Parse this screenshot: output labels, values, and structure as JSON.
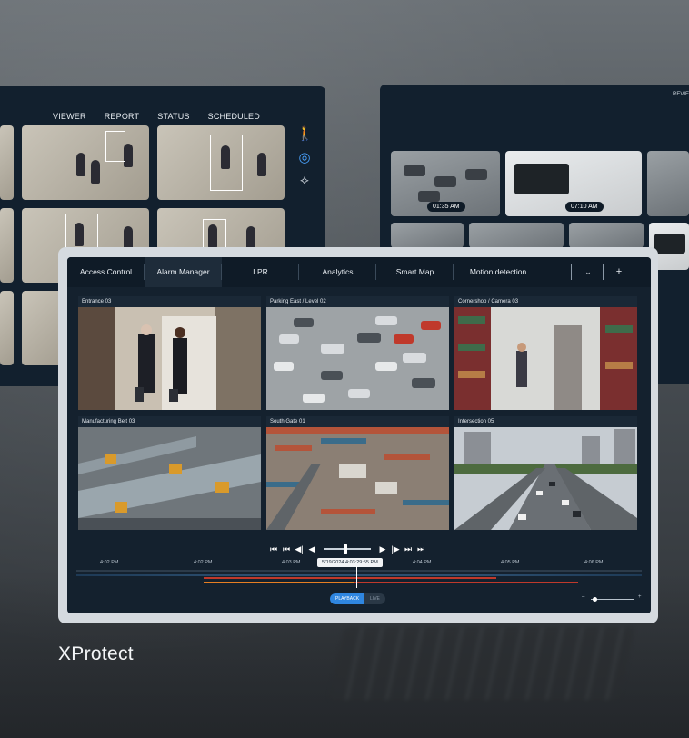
{
  "brand": {
    "name": "XProtect"
  },
  "back_right_panel": {
    "top_link": "REVIE",
    "tabs": [
      "VIEWER",
      "REPORT",
      "STATUS",
      "SCHEDULED"
    ],
    "timestamps": [
      "01:35 AM",
      "07:10 AM"
    ]
  },
  "main": {
    "tabs": [
      {
        "label": "Access Control"
      },
      {
        "label": "Alarm Manager"
      },
      {
        "label": "LPR"
      },
      {
        "label": "Analytics"
      },
      {
        "label": "Smart Map"
      },
      {
        "label": "Motion detection"
      }
    ],
    "tab_actions": {
      "dropdown": "⌄",
      "add": "+"
    },
    "cameras": [
      {
        "label": "Entrance 03"
      },
      {
        "label": "Parking East / Level 02"
      },
      {
        "label": "Cornershop / Camera 03"
      },
      {
        "label": "Manufacturing Belt 03"
      },
      {
        "label": "South Gate 01"
      },
      {
        "label": "Intersection 05"
      }
    ],
    "playback": {
      "buttons": [
        "⏮",
        "⏮",
        "◀|",
        "◀",
        "▶",
        "|▶",
        "⏭",
        "⏭"
      ],
      "timeline_labels": [
        "4:02 PM",
        "4:02 PM",
        "4:03 PM",
        "4:04 PM",
        "4:05 PM",
        "4:06 PM"
      ],
      "current_datetime": "5/19/2024   4:03:29:55 PM",
      "mode_playback": "PLAYBACK",
      "mode_live": "LIVE",
      "zoom_minus": "–",
      "zoom_plus": "+"
    }
  },
  "colors": {
    "panel": "#14212e",
    "accent": "#2f86e0",
    "timeline_red": "#c0392b",
    "timeline_orange": "#e67e22"
  }
}
